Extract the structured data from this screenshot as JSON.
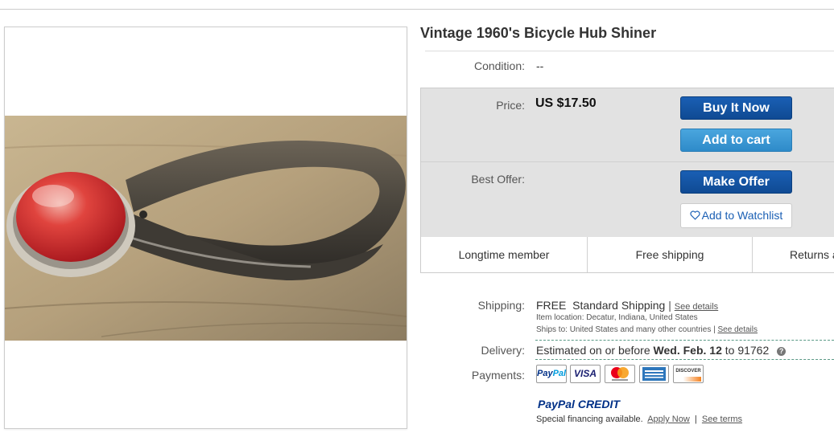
{
  "listing": {
    "title": "Vintage 1960's Bicycle Hub Shiner",
    "condition_label": "Condition:",
    "condition_value": "--"
  },
  "purchase": {
    "price_label": "Price:",
    "price": "US $17.50",
    "buy_now_label": "Buy It Now",
    "add_to_cart_label": "Add to cart",
    "best_offer_label": "Best Offer:",
    "make_offer_label": "Make Offer",
    "watchlist_label": "Add to Watchlist",
    "watchlist_icon": "heart-icon"
  },
  "features": [
    "Longtime member",
    "Free shipping",
    "Returns a"
  ],
  "shipping": {
    "label": "Shipping:",
    "free": "FREE",
    "method": "Standard Shipping",
    "separator": "|",
    "see_details": "See details",
    "item_location": "Item location:  Decatur, Indiana, United States",
    "ships_to": "Ships to:  United States and many other countries",
    "ships_to_separator": "|",
    "ships_to_details": "See details"
  },
  "delivery": {
    "label": "Delivery:",
    "prefix": "Estimated on or before",
    "date": "Wed. Feb. 12",
    "to": "to",
    "zip": "91762",
    "help_symbol": "?"
  },
  "payments": {
    "label": "Payments:",
    "methods": [
      "PayPal",
      "VISA",
      "Mastercard",
      "American Express",
      "DISCOVER"
    ],
    "paypal_pay": "Pay",
    "paypal_pal": "Pal",
    "paypal_credit_pay": "PayPal",
    "paypal_credit_word": "CREDIT",
    "financing_text": "Special financing available.",
    "apply_now": "Apply Now",
    "separator": "|",
    "see_terms": "See terms"
  },
  "colors": {
    "primary_button": "#0f4a93",
    "secondary_button": "#2e8bc9",
    "link": "#1a5fb4",
    "reflector_red": "#d8262c",
    "paypal_dark": "#003087",
    "paypal_light": "#009cde"
  }
}
